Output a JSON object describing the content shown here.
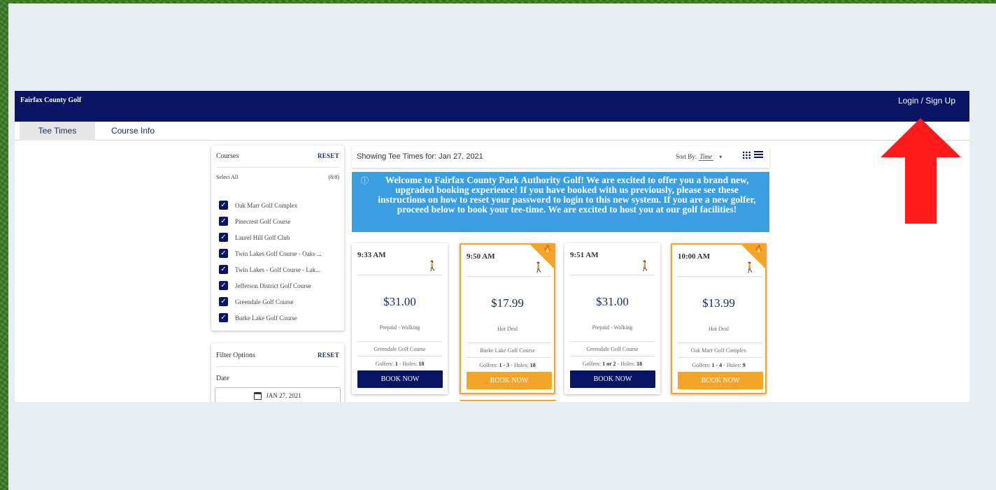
{
  "header": {
    "brand": "Fairfax County Golf",
    "login": "Login / Sign Up"
  },
  "tabs": [
    {
      "label": "Tee Times"
    },
    {
      "label": "Course Info"
    }
  ],
  "courses_panel": {
    "title": "Courses",
    "reset": "RESET",
    "select_all": "Select All",
    "count": "(8/8)",
    "items": [
      {
        "label": "Oak Marr Golf Complex"
      },
      {
        "label": "Pinecrest Golf Course"
      },
      {
        "label": "Laurel Hill Golf Club"
      },
      {
        "label": "Twin Lakes Golf Course - Oaks ..."
      },
      {
        "label": "Twin Lakes - Golf Course - Lak..."
      },
      {
        "label": "Jefferson District Golf Course"
      },
      {
        "label": "Greendale Golf Course"
      },
      {
        "label": "Burke Lake Golf Course"
      }
    ]
  },
  "filter_panel": {
    "title": "Filter Options",
    "reset": "RESET",
    "date_label": "Date",
    "date_value": "JAN 27, 2021"
  },
  "results": {
    "showing": "Showing Tee Times for: Jan 27, 2021",
    "sort_label": "Sort By:",
    "sort_value": "Time"
  },
  "welcome": {
    "info_icon": "ⓘ",
    "text": "Welcome to Fairfax County Park Authority Golf!  We are excited to offer you a brand new, upgraded booking experience!  If you have booked with us previously, please see these instructions on how to reset your password to login to this new system.  If you are a new golfer, proceed below to book your tee-time. We are excited to host you at our golf facilities!"
  },
  "cards": [
    {
      "time": "9:33 AM",
      "price": "$31.00",
      "type": "Prepaid - Walking",
      "course": "Greendale Golf Course",
      "golfers_prefix": "Golfers: ",
      "golfers": "1",
      "holes_prefix": " - Holes: ",
      "holes": "18",
      "book": "BOOK NOW",
      "hot": false
    },
    {
      "time": "9:50 AM",
      "price": "$17.99",
      "type": "Hot Deal",
      "course": "Burke Lake Golf Course",
      "golfers_prefix": "Golfers: ",
      "golfers": "1 - 3",
      "holes_prefix": " - Holes: ",
      "holes": "18",
      "book": "BOOK NOW",
      "hot": true
    },
    {
      "time": "9:51 AM",
      "price": "$31.00",
      "type": "Prepaid - Walking",
      "course": "Greendale Golf Course",
      "golfers_prefix": "Golfers: ",
      "golfers": "1 or 2",
      "holes_prefix": " - Holes: ",
      "holes": "18",
      "book": "BOOK NOW",
      "hot": false
    },
    {
      "time": "10:00 AM",
      "price": "$13.99",
      "type": "Hot Deal",
      "course": "Oak Marr Golf Complex",
      "golfers_prefix": "Golfers: ",
      "golfers": "1 - 4",
      "holes_prefix": " - Holes: ",
      "holes": "9",
      "book": "BOOK NOW",
      "hot": true
    }
  ],
  "icons": {
    "check": "✓",
    "walk": "🚶",
    "flame": "🔥",
    "caret": "▾"
  },
  "colors": {
    "navy": "#0a1464",
    "orange": "#f4a429",
    "banner_blue": "#3a9ee0",
    "arrow_red": "#ff1a1a"
  }
}
